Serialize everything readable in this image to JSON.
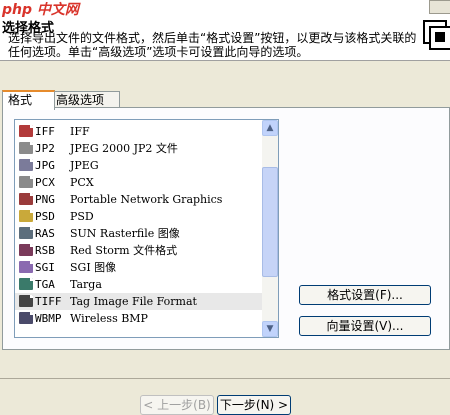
{
  "header": {
    "watermark": "php 中文网",
    "title": "选择格式",
    "description": "选择导出文件的文件格式，然后单击“格式设置”按钮，以更改与该格式关联的任何选项。单击“高级选项”选项卡可设置此向导的选项。"
  },
  "tabs": [
    {
      "label": "格式"
    },
    {
      "label": "高级选项"
    }
  ],
  "formats": [
    {
      "ext": "IFF",
      "name": "IFF",
      "color": "#b23a3a"
    },
    {
      "ext": "JP2",
      "name": "JPEG 2000 JP2 文件",
      "color": "#8b8b8b"
    },
    {
      "ext": "JPG",
      "name": "JPEG",
      "color": "#7b7b9a"
    },
    {
      "ext": "PCX",
      "name": "PCX",
      "color": "#8a8a8a"
    },
    {
      "ext": "PNG",
      "name": "Portable Network Graphics",
      "color": "#9a3b3b"
    },
    {
      "ext": "PSD",
      "name": "PSD",
      "color": "#c9a93a"
    },
    {
      "ext": "RAS",
      "name": "SUN Rasterfile 图像",
      "color": "#5c6e7c"
    },
    {
      "ext": "RSB",
      "name": "Red Storm 文件格式",
      "color": "#7a3a5a"
    },
    {
      "ext": "SGI",
      "name": "SGI 图像",
      "color": "#8a6ab0"
    },
    {
      "ext": "TGA",
      "name": "Targa",
      "color": "#3a7a6a"
    },
    {
      "ext": "TIFF",
      "name": "Tag Image File Format",
      "color": "#444444"
    },
    {
      "ext": "WBMP",
      "name": "Wireless BMP",
      "color": "#4a4a6a"
    }
  ],
  "selected_index": 10,
  "buttons": {
    "format_settings": "格式设置(F)...",
    "vector_settings": "向量设置(V)..."
  },
  "navigation": {
    "back": "< 上一步(B)",
    "next": "下一步(N) >"
  }
}
